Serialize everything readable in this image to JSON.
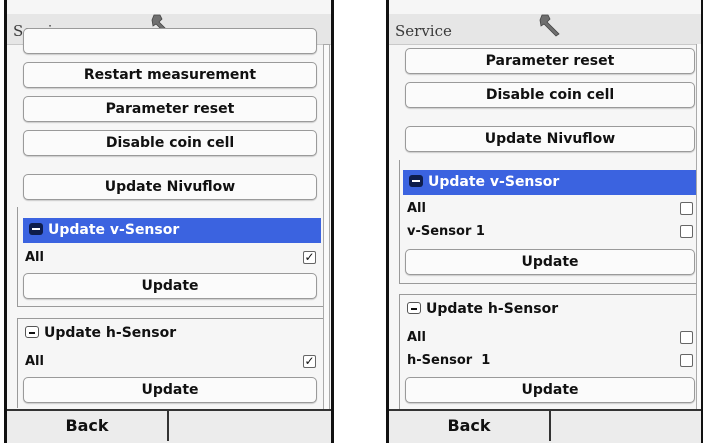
{
  "left_screen": {
    "title": "Service",
    "buttons": {
      "restart": "Restart measurement",
      "param_reset": "Parameter reset",
      "disable_coin": "Disable coin cell",
      "update_nivuflow": "Update Nivuflow"
    },
    "v_sensor": {
      "header": "Update v-Sensor",
      "rows": [
        {
          "label": "All",
          "checked": true
        }
      ],
      "update_label": "Update"
    },
    "h_sensor": {
      "header": "Update h-Sensor",
      "rows": [
        {
          "label": "All",
          "checked": true
        }
      ],
      "update_label": "Update"
    },
    "back_label": "Back"
  },
  "right_screen": {
    "title": "Service",
    "buttons": {
      "param_reset": "Parameter reset",
      "disable_coin": "Disable coin cell",
      "update_nivuflow": "Update Nivuflow"
    },
    "v_sensor": {
      "header": "Update v-Sensor",
      "rows": [
        {
          "label": "All",
          "checked": false
        },
        {
          "label": "v-Sensor 1",
          "checked": false
        }
      ],
      "update_label": "Update"
    },
    "h_sensor": {
      "header": "Update h-Sensor",
      "rows": [
        {
          "label": "All",
          "checked": false
        },
        {
          "label": "h-Sensor  1",
          "checked": false
        }
      ],
      "update_label": "Update"
    },
    "back_label": "Back"
  },
  "colors": {
    "selection": "#3b63e0",
    "toggle_dark": "#0e1d4c"
  },
  "icons": {
    "title_icon": "wrench-icon",
    "checked": "checkmark-icon"
  }
}
